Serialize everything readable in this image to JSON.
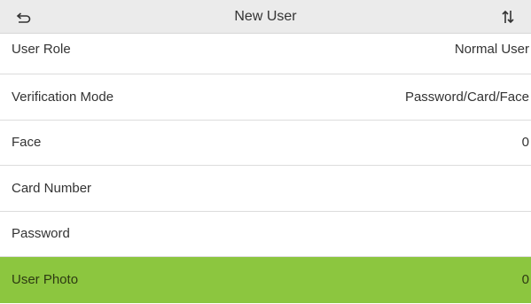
{
  "header": {
    "title": "New User",
    "back_icon": "return-arrow-icon",
    "sort_icon": "sort-arrows-icon"
  },
  "rows": [
    {
      "label": "User Role",
      "value": "Normal User"
    },
    {
      "label": "Verification Mode",
      "value": "Password/Card/Face"
    },
    {
      "label": "Face",
      "value": "0"
    },
    {
      "label": "Card Number",
      "value": ""
    },
    {
      "label": "Password",
      "value": ""
    },
    {
      "label": "User Photo",
      "value": "0"
    }
  ],
  "colors": {
    "header_bg": "#ebebeb",
    "selected_bg": "#8cc63f",
    "divider": "#dcdcdc"
  }
}
